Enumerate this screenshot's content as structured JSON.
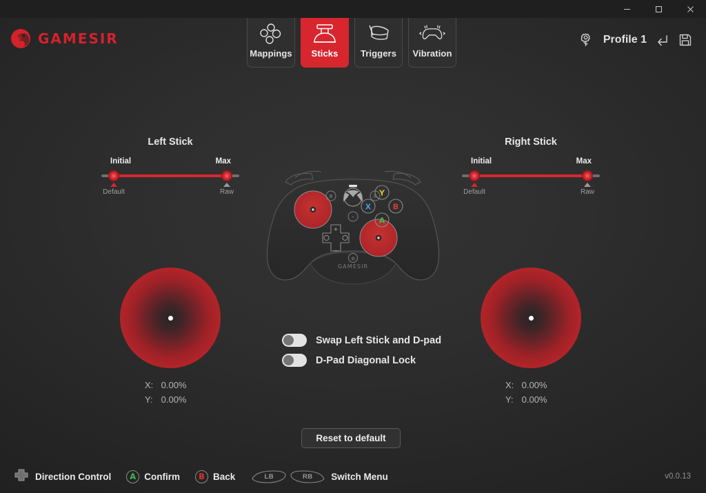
{
  "window": {
    "controls": [
      {
        "name": "minimize",
        "glyph": "minimize-icon"
      },
      {
        "name": "maximize",
        "glyph": "maximize-icon"
      },
      {
        "name": "close",
        "glyph": "close-icon"
      }
    ]
  },
  "header": {
    "brand_text": "GAMESIR",
    "brand_color": "#d4222c",
    "tabs": [
      {
        "label": "Mappings",
        "icon": "dpad-dots-icon",
        "active": false
      },
      {
        "label": "Sticks",
        "icon": "thumbstick-icon",
        "active": true
      },
      {
        "label": "Triggers",
        "icon": "trigger-icon",
        "active": false
      },
      {
        "label": "Vibration",
        "icon": "vibration-icon",
        "active": false
      }
    ],
    "active_tab": "Sticks",
    "profile": {
      "settings_icon": "gear-tree-icon",
      "name": "Profile 1",
      "undo_icon": "undo-arrow-icon",
      "save_icon": "floppy-disk-icon"
    }
  },
  "sticks": [
    {
      "id": "left",
      "title": "Left Stick",
      "slider": {
        "initial_label": "Initial",
        "max_label": "Max",
        "initial_value": 0,
        "max_value": 100,
        "marks": [
          {
            "label": "Default",
            "position": 0,
            "color": "#d8262f"
          },
          {
            "label": "Raw",
            "position": 100,
            "color": "#9a9a9a"
          }
        ]
      },
      "readout": {
        "x_label": "X:",
        "x_value": "0.00%",
        "y_label": "Y:",
        "y_value": "0.00%"
      }
    },
    {
      "id": "right",
      "title": "Right Stick",
      "slider": {
        "initial_label": "Initial",
        "max_label": "Max",
        "initial_value": 0,
        "max_value": 100,
        "marks": [
          {
            "label": "Default",
            "position": 0,
            "color": "#d8262f"
          },
          {
            "label": "Raw",
            "position": 100,
            "color": "#9a9a9a"
          }
        ]
      },
      "readout": {
        "x_label": "X:",
        "x_value": "0.00%",
        "y_label": "Y:",
        "y_value": "0.00%"
      }
    }
  ],
  "controller": {
    "brand_label": "GAMESIR",
    "face_buttons": [
      {
        "label": "Y",
        "color": "#d8c02e"
      },
      {
        "label": "X",
        "color": "#3b9fd8"
      },
      {
        "label": "B",
        "color": "#d33a3a"
      },
      {
        "label": "A",
        "color": "#3fb950"
      }
    ],
    "stick_color": "#b8282e",
    "body_color": "#2c2c2c"
  },
  "options": [
    {
      "label": "Swap Left Stick and D-pad",
      "enabled": false
    },
    {
      "label": "D-Pad Diagonal Lock",
      "enabled": false
    }
  ],
  "actions": {
    "reset_label": "Reset to default"
  },
  "footer": {
    "legend": [
      {
        "icon": "dpad-icon",
        "label": "Direction Control"
      },
      {
        "icon": "a-button-icon",
        "label": "Confirm",
        "glyph": "A",
        "color": "#3fb950"
      },
      {
        "icon": "b-button-icon",
        "label": "Back",
        "glyph": "B",
        "color": "#e03030"
      },
      {
        "icon": "shoulder-icon",
        "label": "Switch Menu",
        "lb": "LB",
        "rb": "RB"
      }
    ],
    "version": "v0.0.13"
  }
}
